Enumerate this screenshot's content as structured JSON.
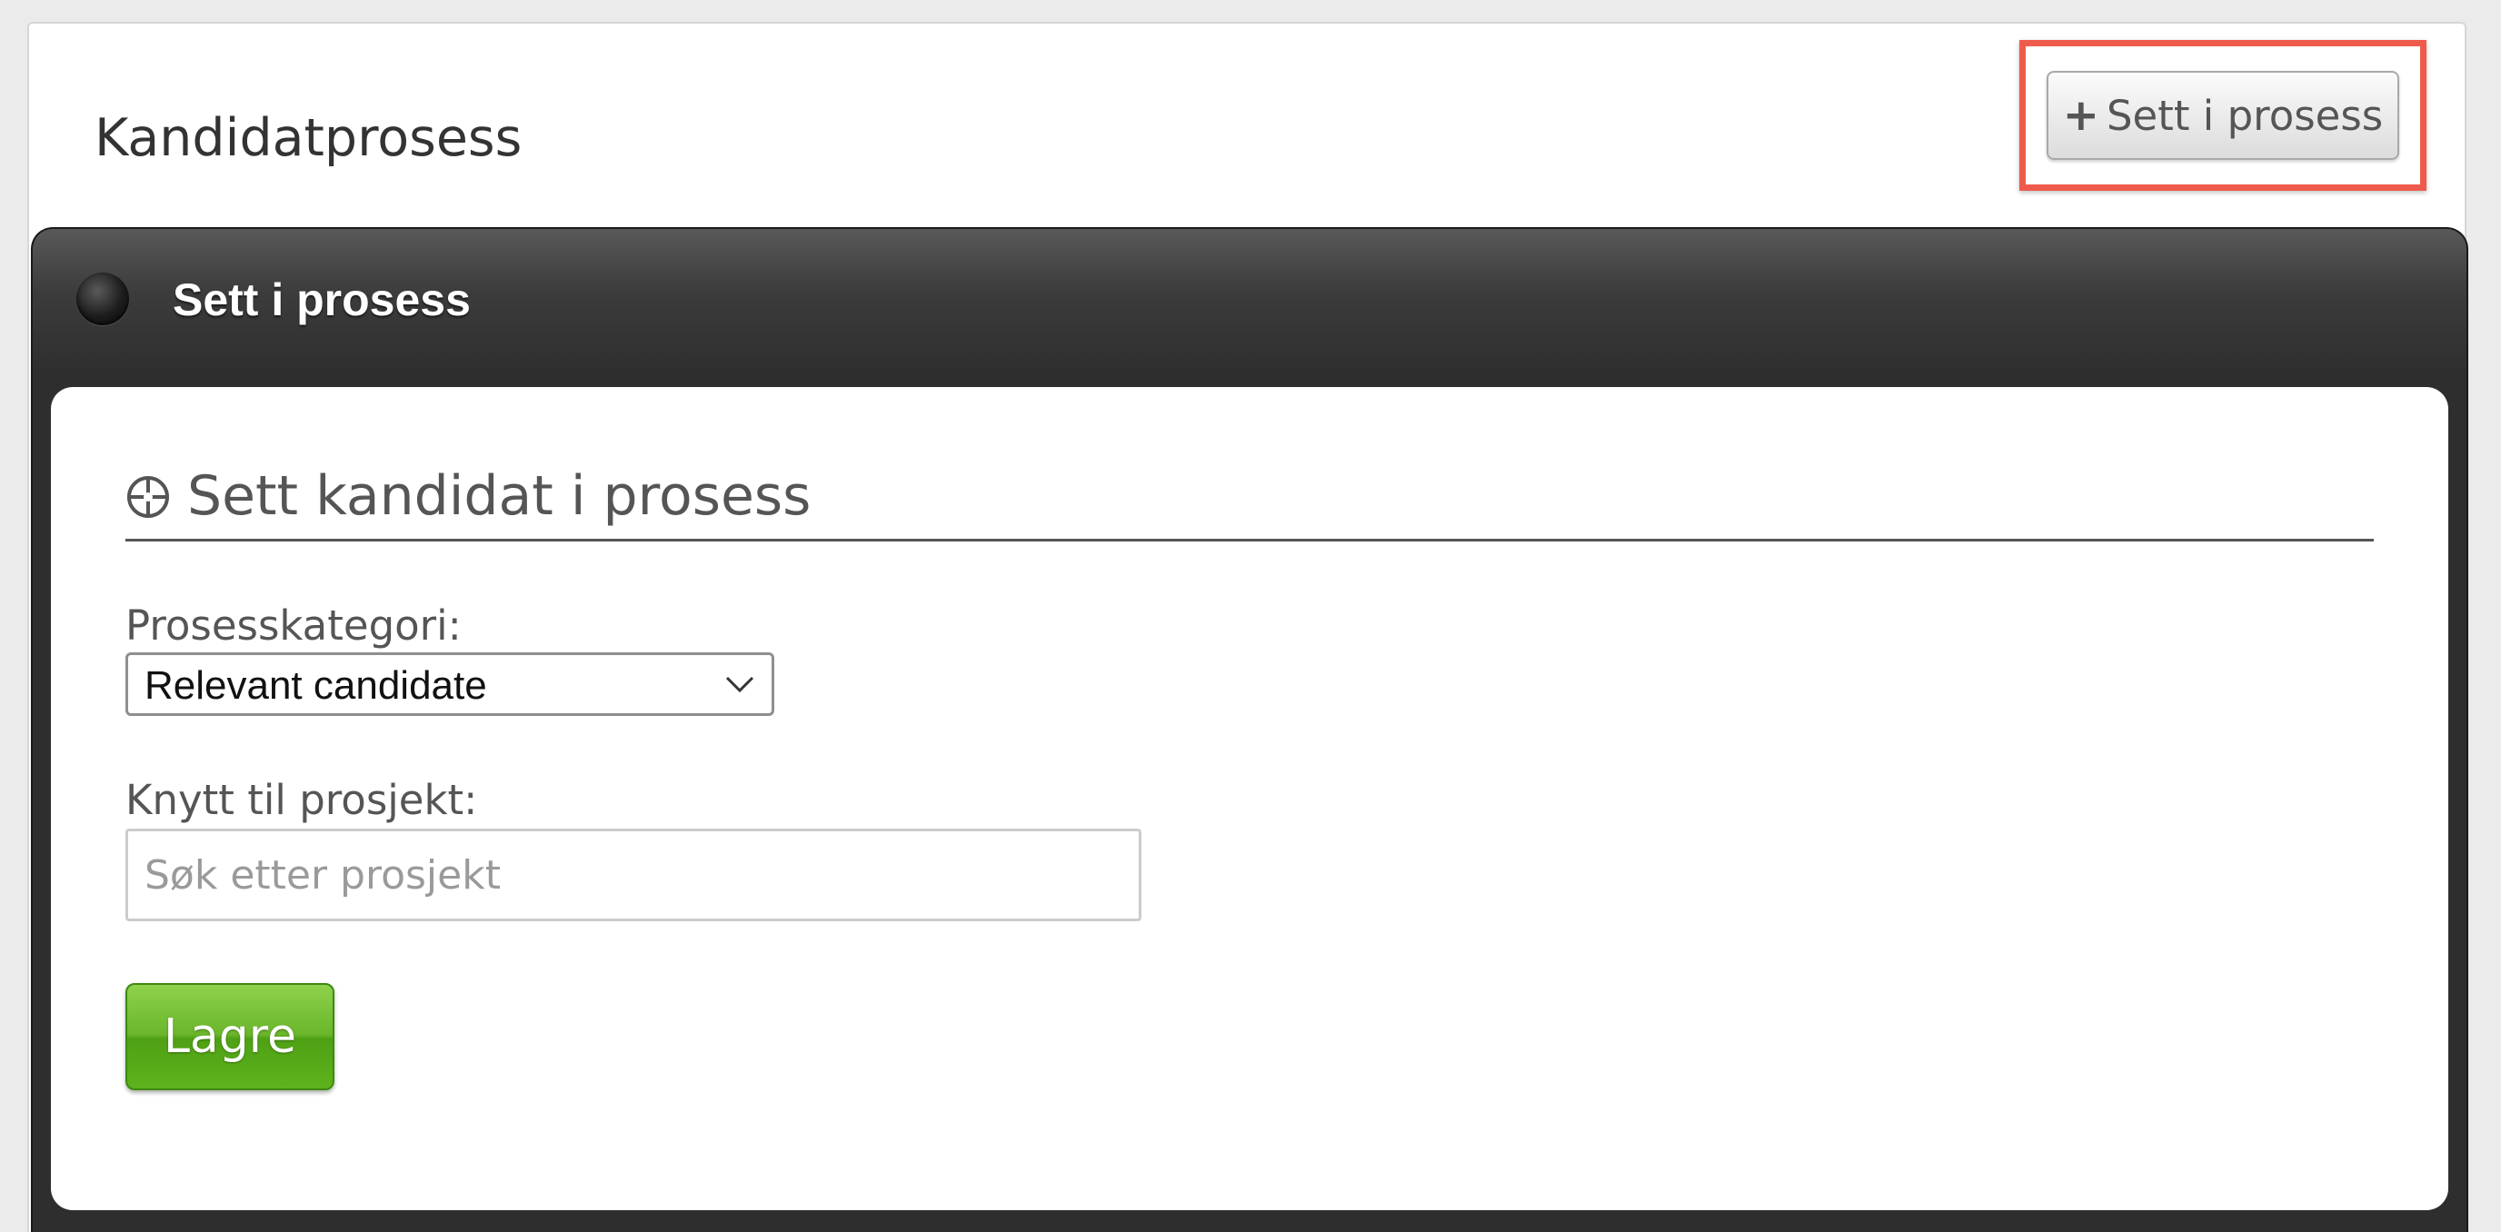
{
  "card": {
    "title": "Kandidatprosess",
    "add_button_label": "Sett i prosess",
    "add_button_icon": "plus-icon",
    "highlight_color": "#ee5b4c"
  },
  "modal": {
    "title": "Sett i prosess",
    "section_title": "Sett kandidat i prosess",
    "section_icon": "crosshair-icon",
    "category_label": "Prosesskategori:",
    "category_value": "Relevant candidate",
    "project_label": "Knytt til prosjekt:",
    "project_value": "",
    "project_placeholder": "Søk etter prosjekt",
    "save_label": "Lagre",
    "save_color": "#5db31c"
  }
}
